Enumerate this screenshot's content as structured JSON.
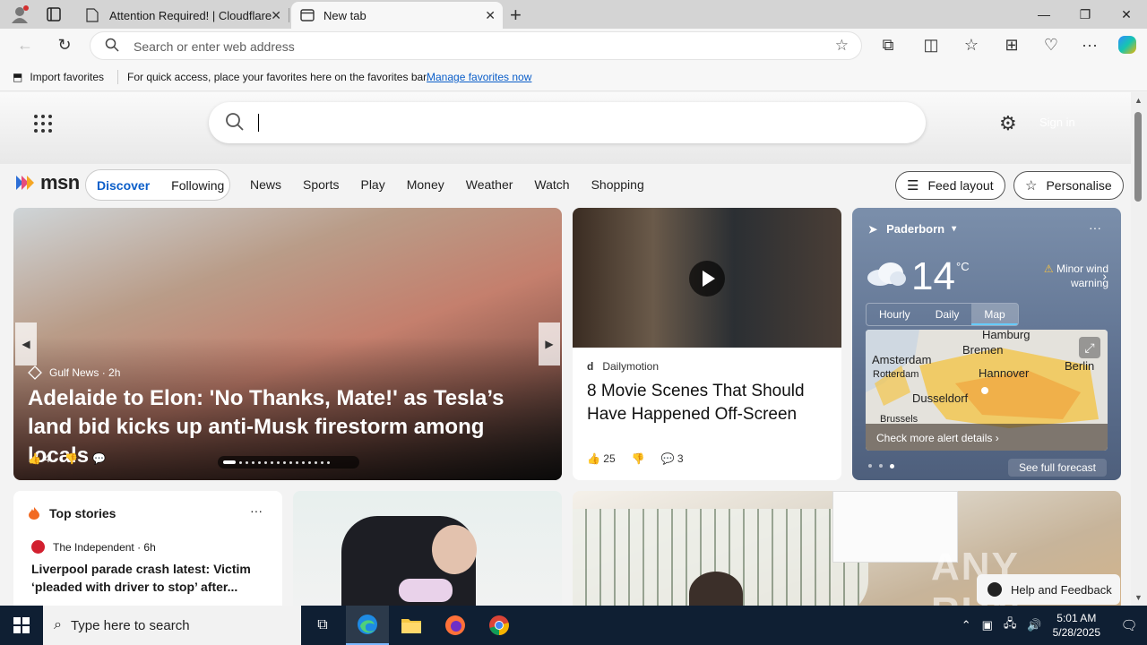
{
  "browser": {
    "tabs": [
      {
        "title": "Attention Required! | Cloudflare",
        "active": false
      },
      {
        "title": "New tab",
        "active": true
      }
    ],
    "address": {
      "placeholder": "Search or enter web address"
    },
    "favorites_bar": {
      "import_label": "Import favorites",
      "message": "For quick access, place your favorites here on the favorites bar.",
      "manage_link": "Manage favorites now"
    }
  },
  "msn": {
    "signin_label": "Sign in",
    "logo_text": "msn",
    "pills": [
      "Discover",
      "Following"
    ],
    "nav": [
      "News",
      "Sports",
      "Play",
      "Money",
      "Weather",
      "Watch",
      "Shopping"
    ],
    "feed_layout_label": "Feed layout",
    "personalise_label": "Personalise",
    "hero": {
      "source": "Gulf News",
      "age": "2h",
      "title": "Adelaide to Elon: 'No Thanks, Mate!' as Tesla’s land bid kicks up anti-Musk firestorm among locals",
      "likes": "4",
      "slides": 16,
      "current_slide": 1
    },
    "video_card": {
      "source": "Dailymotion",
      "title": "8 Movie Scenes That Should Have Happened Off-Screen",
      "likes": "25",
      "comments": "3"
    },
    "weather": {
      "location": "Paderborn",
      "temperature": "14",
      "unit": "°C",
      "warning": "Minor wind warning",
      "tabs": [
        "Hourly",
        "Daily",
        "Map"
      ],
      "active_tab": "Map",
      "map_labels": [
        "Hamburg",
        "Bremen",
        "Amsterdam",
        "Rotterdam",
        "Hannover",
        "Berlin",
        "Dusseldorf",
        "Brussels"
      ],
      "alert_link": "Check more alert details",
      "forecast_link": "See full forecast"
    },
    "top_stories": {
      "heading": "Top stories",
      "source": "The Independent",
      "age": "6h",
      "title": "Liverpool parade crash latest: Victim ‘pleaded with driver to stop’ after..."
    },
    "help_label": "Help and Feedback",
    "watermark": "ANY RUN"
  },
  "taskbar": {
    "search_placeholder": "Type here to search",
    "time": "5:01 AM",
    "date": "5/28/2025"
  }
}
